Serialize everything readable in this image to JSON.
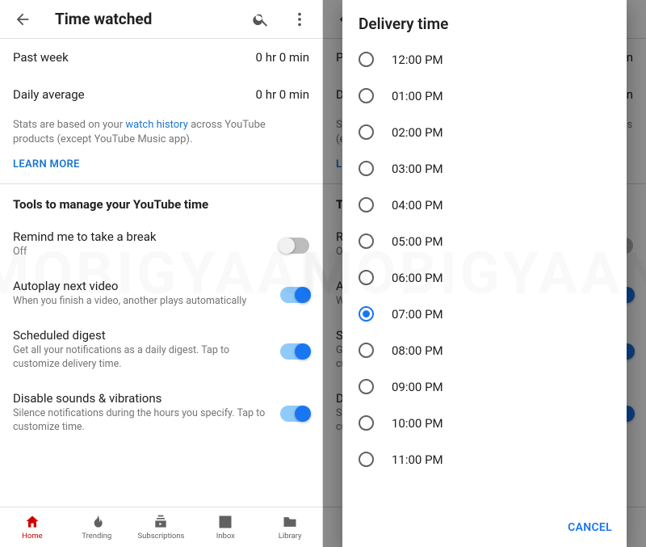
{
  "left": {
    "appbar_title": "Time watched",
    "stats": {
      "past_week_label": "Past week",
      "past_week_value": "0 hr 0 min",
      "daily_avg_label": "Daily average",
      "daily_avg_value": "0 hr 0 min"
    },
    "note_pre": "Stats are based on your ",
    "note_link": "watch history",
    "note_post": " across YouTube products (except YouTube Music app).",
    "learn_more": "LEARN MORE",
    "section_title": "Tools to manage your YouTube time",
    "settings": {
      "remind_title": "Remind me to take a break",
      "remind_sub": "Off",
      "autoplay_title": "Autoplay next video",
      "autoplay_sub": "When you finish a video, another plays automatically",
      "digest_title": "Scheduled digest",
      "digest_sub": "Get all your notifications as a daily digest. Tap to customize delivery time.",
      "disable_title": "Disable sounds & vibrations",
      "disable_sub": "Silence notifications during the hours you specify. Tap to customize time."
    }
  },
  "right_dialog": {
    "title": "Delivery time",
    "options": [
      "12:00 PM",
      "01:00 PM",
      "02:00 PM",
      "03:00 PM",
      "04:00 PM",
      "05:00 PM",
      "06:00 PM",
      "07:00 PM",
      "08:00 PM",
      "09:00 PM",
      "10:00 PM",
      "11:00 PM"
    ],
    "selected": "07:00 PM",
    "cancel": "CANCEL"
  },
  "nav": {
    "home": "Home",
    "trending": "Trending",
    "subs": "Subscriptions",
    "inbox": "Inbox",
    "library": "Library"
  }
}
